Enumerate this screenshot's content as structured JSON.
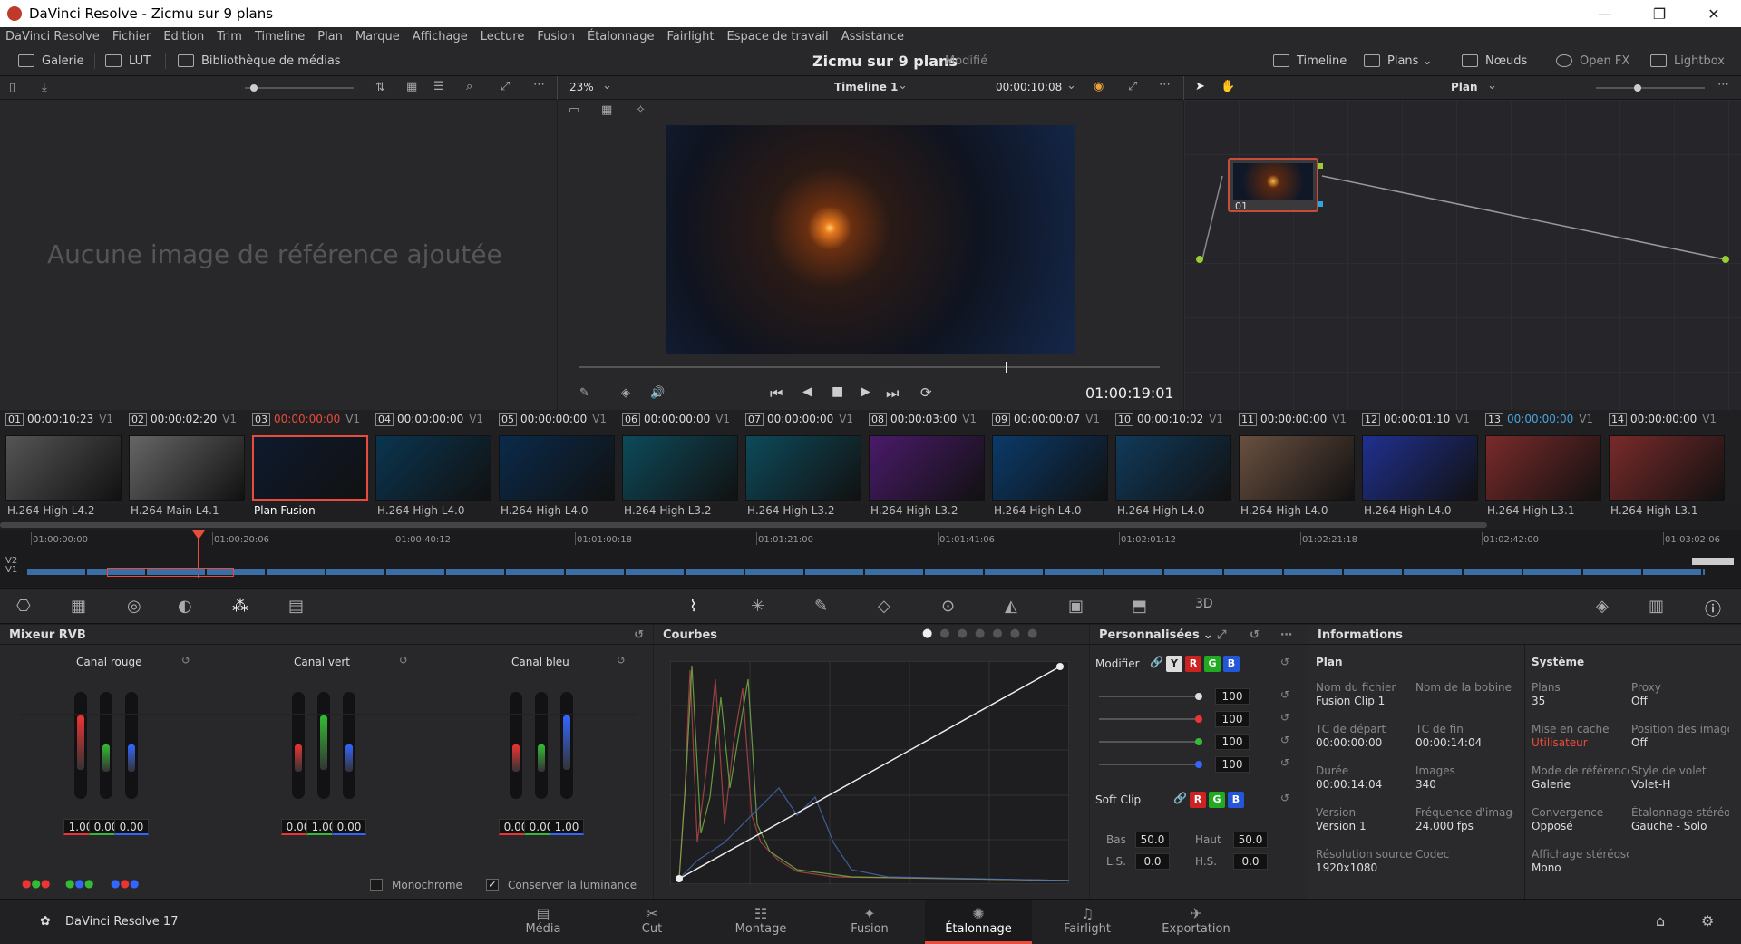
{
  "window": {
    "title": "DaVinci Resolve - Zicmu sur 9 plans",
    "min": "—",
    "max": "❐",
    "close": "✕"
  },
  "menu": [
    "DaVinci Resolve",
    "Fichier",
    "Edition",
    "Trim",
    "Timeline",
    "Plan",
    "Marque",
    "Affichage",
    "Lecture",
    "Fusion",
    "Étalonnage",
    "Fairlight",
    "Espace de travail",
    "Assistance"
  ],
  "toolbar": {
    "gallery": "Galerie",
    "lut": "LUT",
    "media_library": "Bibliothèque de médias",
    "project_title": "Zicmu sur 9 plans",
    "modified": "Modifié",
    "timeline": "Timeline",
    "clips": "Plans",
    "nodes": "Nœuds",
    "openfx": "Open FX",
    "lightbox": "Lightbox"
  },
  "viewer": {
    "zoom": "23%",
    "timeline_name": "Timeline 1",
    "timecode_top": "00:00:10:08",
    "timecode": "01:00:19:01"
  },
  "gallery": {
    "empty_message": "Aucune image de référence ajoutée"
  },
  "nodes": {
    "mode": "Plan",
    "node_label": "01"
  },
  "clips": [
    {
      "num": "01",
      "tc": "00:00:10:23",
      "track": "V1",
      "codec": "H.264 High L4.2",
      "color": "#555"
    },
    {
      "num": "02",
      "tc": "00:00:02:20",
      "track": "V1",
      "codec": "H.264 Main L4.1",
      "color": "#666"
    },
    {
      "num": "03",
      "tc": "00:00:00:00",
      "track": "V1",
      "codec": "Plan Fusion",
      "color": "#0e1a2e"
    },
    {
      "num": "04",
      "tc": "00:00:00:00",
      "track": "V1",
      "codec": "H.264 High L4.0",
      "color": "#0a3550"
    },
    {
      "num": "05",
      "tc": "00:00:00:00",
      "track": "V1",
      "codec": "H.264 High L4.0",
      "color": "#0a2a4a"
    },
    {
      "num": "06",
      "tc": "00:00:00:00",
      "track": "V1",
      "codec": "H.264 High L3.2",
      "color": "#0d4a5a"
    },
    {
      "num": "07",
      "tc": "00:00:00:00",
      "track": "V1",
      "codec": "H.264 High L3.2",
      "color": "#0d4a5a"
    },
    {
      "num": "08",
      "tc": "00:00:03:00",
      "track": "V1",
      "codec": "H.264 High L3.2",
      "color": "#4a1a6a"
    },
    {
      "num": "09",
      "tc": "00:00:00:07",
      "track": "V1",
      "codec": "H.264 High L4.0",
      "color": "#0a3a6a"
    },
    {
      "num": "10",
      "tc": "00:00:10:02",
      "track": "V1",
      "codec": "H.264 High L4.0",
      "color": "#103a5a"
    },
    {
      "num": "11",
      "tc": "00:00:00:00",
      "track": "V1",
      "codec": "H.264 High L4.0",
      "color": "#6a5040"
    },
    {
      "num": "12",
      "tc": "00:00:01:10",
      "track": "V1",
      "codec": "H.264 High L4.0",
      "color": "#203090"
    },
    {
      "num": "13",
      "tc": "00:00:00:00",
      "track": "V1",
      "codec": "H.264 High L3.1",
      "color": "#7a2a2a"
    },
    {
      "num": "14",
      "tc": "00:00:00:00",
      "track": "V1",
      "codec": "H.264 High L3.1",
      "color": "#7a2a2a"
    }
  ],
  "ruler": [
    "01:00:00:00",
    "01:00:20:06",
    "01:00:40:12",
    "01:01:00:18",
    "01:01:21:00",
    "01:01:41:06",
    "01:02:01:12",
    "01:02:21:18",
    "01:02:42:00",
    "01:03:02:06"
  ],
  "tracks": [
    "V2",
    "V1"
  ],
  "rgb_mixer": {
    "title": "Mixeur RVB",
    "channels": [
      {
        "name": "Canal rouge",
        "values": [
          "1.00",
          "0.00",
          "0.00"
        ]
      },
      {
        "name": "Canal vert",
        "values": [
          "0.00",
          "1.00",
          "0.00"
        ]
      },
      {
        "name": "Canal bleu",
        "values": [
          "0.00",
          "0.00",
          "1.00"
        ]
      }
    ],
    "monochrome": "Monochrome",
    "preserve_lum": "Conserver la luminance"
  },
  "curves": {
    "title": "Courbes"
  },
  "custom": {
    "title": "Personnalisées",
    "modifier": "Modifier",
    "softclip": "Soft Clip",
    "levels": [
      "100",
      "100",
      "100",
      "100"
    ],
    "bas_label": "Bas",
    "bas": "50.0",
    "haut_label": "Haut",
    "haut": "50.0",
    "ls_label": "L.S.",
    "ls": "0.0",
    "hs_label": "H.S.",
    "hs": "0.0"
  },
  "info": {
    "title": "Informations",
    "plan": "Plan",
    "system": "Système",
    "rows": [
      {
        "l": "Nom du fichier",
        "v": "Fusion Clip 1",
        "l2": "Nom de la bobine",
        "v2": ""
      },
      {
        "l": "TC de départ",
        "v": "00:00:00:00",
        "l2": "TC de fin",
        "v2": "00:00:14:04"
      },
      {
        "l": "Durée",
        "v": "00:00:14:04",
        "l2": "Images",
        "v2": "340"
      },
      {
        "l": "Version",
        "v": "Version 1",
        "l2": "Fréquence d'image",
        "v2": "24.000 fps"
      },
      {
        "l": "Résolution source",
        "v": "1920x1080",
        "l2": "Codec",
        "v2": ""
      }
    ],
    "sys_rows": [
      {
        "l": "Plans",
        "v": "35",
        "l2": "Proxy",
        "v2": "Off"
      },
      {
        "l": "Mise en cache",
        "v": "Utilisateur",
        "l2": "Position des images",
        "v2": "Off"
      },
      {
        "l": "Mode de référence",
        "v": "Galerie",
        "l2": "Style de volet",
        "v2": "Volet-H"
      },
      {
        "l": "Convergence",
        "v": "Opposé",
        "l2": "Étalonnage stéréo",
        "v2": "Gauche - Solo"
      },
      {
        "l": "Affichage stéréoscopique",
        "v": "Mono",
        "l2": "",
        "v2": ""
      }
    ]
  },
  "app_name": "DaVinci Resolve 17",
  "nav": [
    "Média",
    "Cut",
    "Montage",
    "Fusion",
    "Étalonnage",
    "Fairlight",
    "Exportation"
  ]
}
